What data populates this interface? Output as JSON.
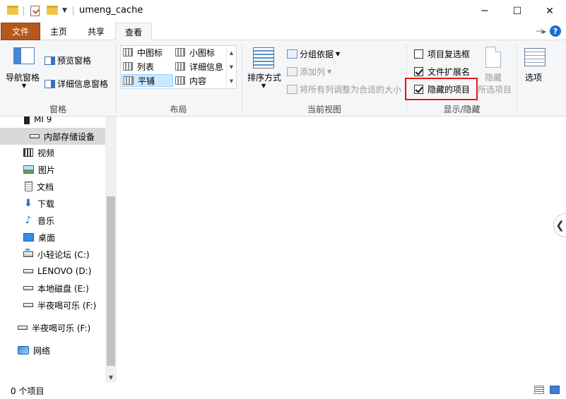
{
  "window": {
    "title": "umeng_cache",
    "minimize": "─",
    "maximize": "☐",
    "close": "✕"
  },
  "tabs": [
    {
      "label": "文件"
    },
    {
      "label": "主页"
    },
    {
      "label": "共享"
    },
    {
      "label": "查看"
    }
  ],
  "ribbon": {
    "panes": {
      "nav_pane": "导航窗格",
      "preview_pane": "预览窗格",
      "details_pane": "详细信息窗格",
      "group_label": "窗格"
    },
    "layout": {
      "items": [
        "中图标",
        "小图标",
        "列表",
        "详细信息",
        "平铺",
        "内容"
      ],
      "selected": "平铺",
      "group_label": "布局"
    },
    "current_view": {
      "sort_by": "排序方式",
      "group_by": "分组依据",
      "add_columns": "添加列",
      "size_columns": "将所有列调整为合适的大小",
      "group_label": "当前视图"
    },
    "show_hide": {
      "item_checkboxes": {
        "label": "项目复选框",
        "checked": false
      },
      "file_extensions": {
        "label": "文件扩展名",
        "checked": true
      },
      "hidden_items": {
        "label": "隐藏的项目",
        "checked": true
      },
      "hide_selected_top": "隐藏",
      "hide_selected_bottom": "所选项目",
      "group_label": "显示/隐藏"
    },
    "options": "选项"
  },
  "nav": {
    "items": [
      {
        "label": "MI 9",
        "icon": "phone-icon"
      },
      {
        "label": "内部存储设备",
        "icon": "drive-icon",
        "selected": true
      },
      {
        "label": "视频",
        "icon": "video-icon"
      },
      {
        "label": "图片",
        "icon": "picture-icon"
      },
      {
        "label": "文档",
        "icon": "document-icon"
      },
      {
        "label": "下载",
        "icon": "download-icon"
      },
      {
        "label": "音乐",
        "icon": "music-icon"
      },
      {
        "label": "桌面",
        "icon": "desktop-icon"
      },
      {
        "label": "小轻论坛 (C:)",
        "icon": "system-drive-icon"
      },
      {
        "label": "LENOVO (D:)",
        "icon": "drive-icon"
      },
      {
        "label": "本地磁盘 (E:)",
        "icon": "drive-icon"
      },
      {
        "label": "半夜喝可乐 (F:)",
        "icon": "drive-icon"
      },
      {
        "label": "半夜喝可乐 (F:)",
        "icon": "drive-icon"
      },
      {
        "label": "网络",
        "icon": "network-icon"
      }
    ]
  },
  "status": {
    "item_count": "0 个项目"
  }
}
